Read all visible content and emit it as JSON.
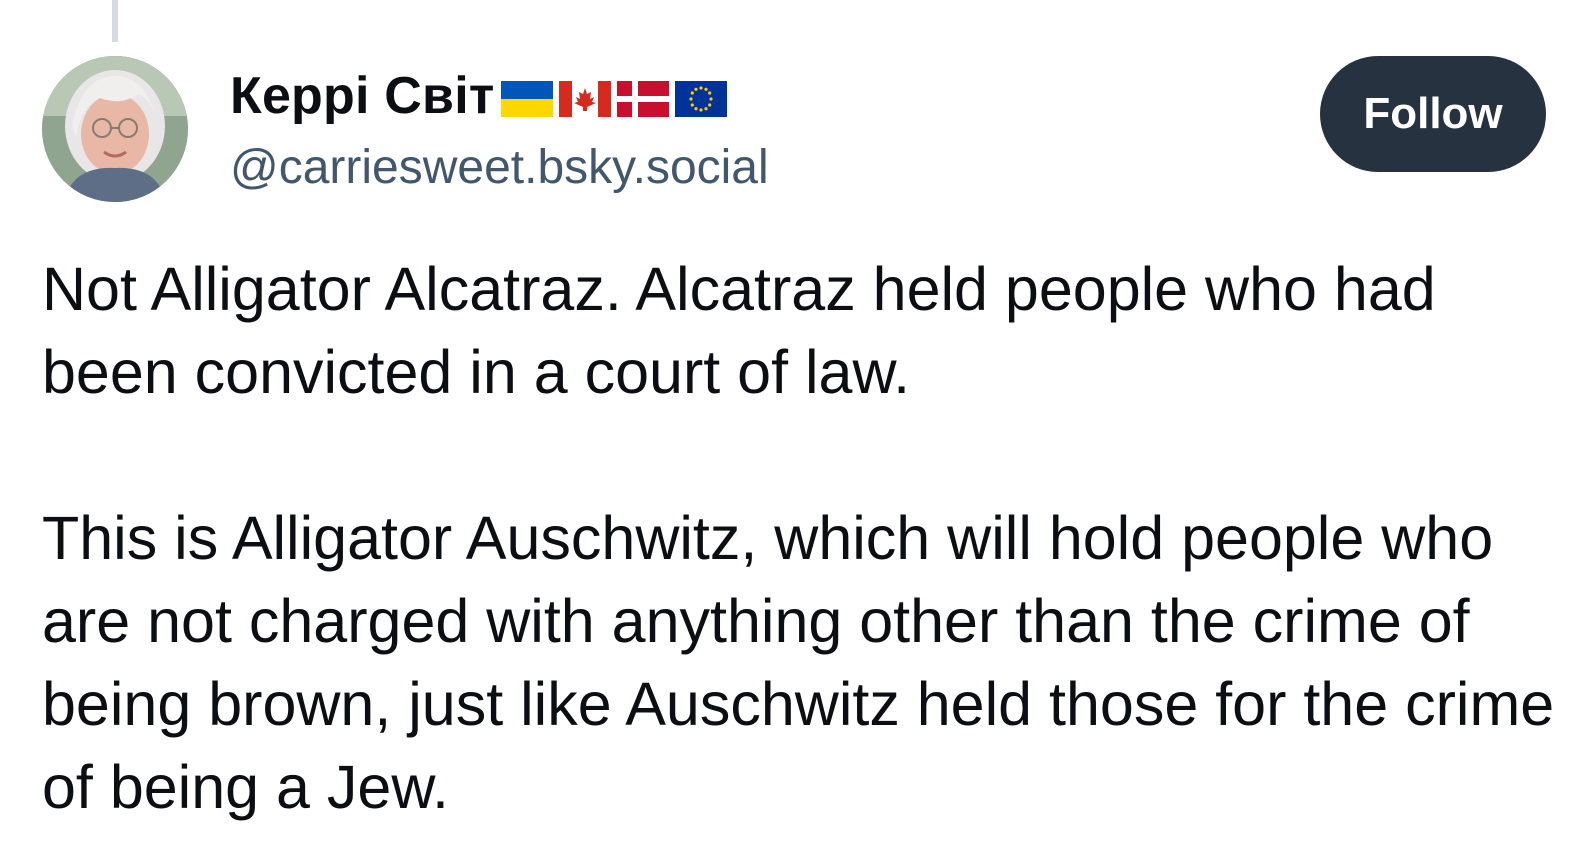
{
  "post": {
    "author": {
      "display_name": "Керрі Світ",
      "flags": [
        {
          "icon": "flag-ukraine-icon",
          "colors": [
            "#0057b7",
            "#ffd700"
          ]
        },
        {
          "icon": "flag-canada-icon",
          "colors": [
            "#d52b1e",
            "#ffffff"
          ]
        },
        {
          "icon": "flag-denmark-icon",
          "colors": [
            "#c8102e",
            "#ffffff"
          ]
        },
        {
          "icon": "flag-eu-icon",
          "colors": [
            "#003399",
            "#ffcc00"
          ]
        }
      ],
      "handle": "@carriesweet.bsky.social",
      "avatar_icon": "avatar-photo"
    },
    "follow_label": "Follow",
    "paragraphs": [
      "Not Alligator Alcatraz. Alcatraz held people who had been convicted in a court of law.",
      "This is Alligator Auschwitz, which will hold people who are not charged with anything other than the crime of being brown, just like Auschwitz held those for the crime of being a Jew."
    ]
  },
  "colors": {
    "follow_bg": "#263240",
    "handle": "#42576c",
    "text": "#0b0f14",
    "thread_line": "#d4dbe2"
  }
}
